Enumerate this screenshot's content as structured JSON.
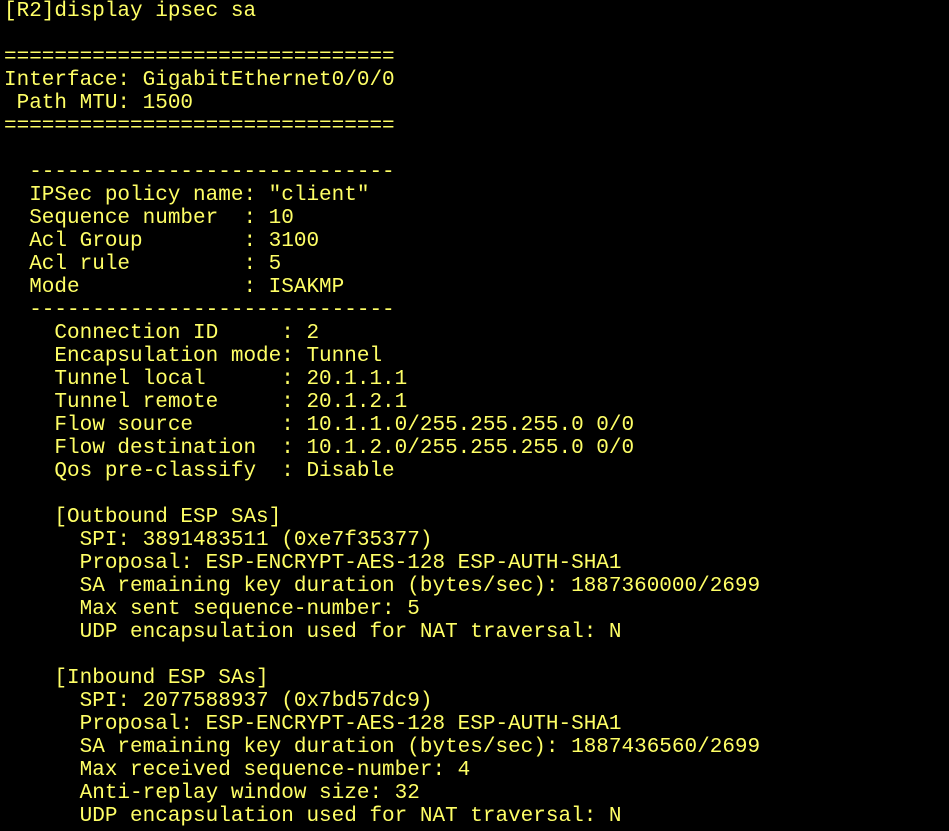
{
  "terminal": {
    "background": "#000000",
    "text_color": "#ffff66",
    "lines": [
      "[R2]display ipsec sa",
      "",
      "===============================",
      "Interface: GigabitEthernet0/0/0",
      " Path MTU: 1500",
      "===============================",
      "",
      "  -----------------------------",
      "  IPSec policy name: \"client\"",
      "  Sequence number  : 10",
      "  Acl Group        : 3100",
      "  Acl rule         : 5",
      "  Mode             : ISAKMP",
      "  -----------------------------",
      "    Connection ID     : 2",
      "    Encapsulation mode: Tunnel",
      "    Tunnel local      : 20.1.1.1",
      "    Tunnel remote     : 20.1.2.1",
      "    Flow source       : 10.1.1.0/255.255.255.0 0/0",
      "    Flow destination  : 10.1.2.0/255.255.255.0 0/0",
      "    Qos pre-classify  : Disable",
      "",
      "    [Outbound ESP SAs]",
      "      SPI: 3891483511 (0xe7f35377)",
      "      Proposal: ESP-ENCRYPT-AES-128 ESP-AUTH-SHA1",
      "      SA remaining key duration (bytes/sec): 1887360000/2699",
      "      Max sent sequence-number: 5",
      "      UDP encapsulation used for NAT traversal: N",
      "",
      "    [Inbound ESP SAs]",
      "      SPI: 2077588937 (0x7bd57dc9)",
      "      Proposal: ESP-ENCRYPT-AES-128 ESP-AUTH-SHA1",
      "      SA remaining key duration (bytes/sec): 1887436560/2699",
      "      Max received sequence-number: 4",
      "      Anti-replay window size: 32",
      "      UDP encapsulation used for NAT traversal: N"
    ]
  }
}
